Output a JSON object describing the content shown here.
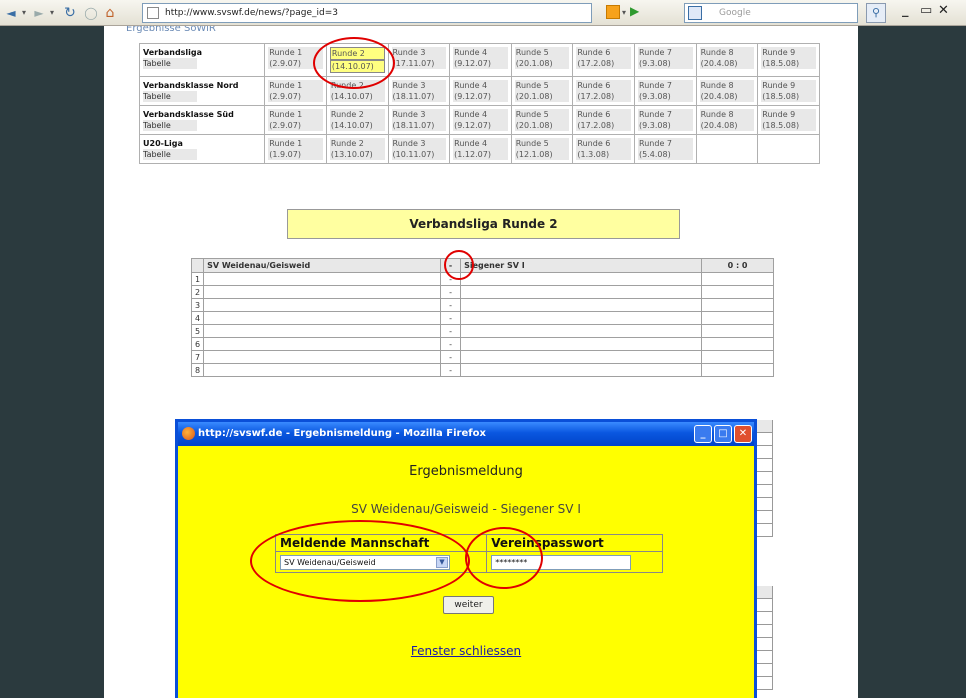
{
  "browser": {
    "url": "http://www.svswf.de/news/?page_id=3",
    "search_placeholder": "Google",
    "back_label": "◄",
    "forward_label": "►",
    "reload_label": "↻",
    "home_label": "⌂",
    "go_label": "▶",
    "minimize_label": "_",
    "restore_label": "ð",
    "close_label": "✕"
  },
  "page": {
    "heading": "Ergebnisse SoWiR",
    "schedule": [
      {
        "league": "Verbandsliga",
        "table": "Tabelle",
        "rounds": [
          [
            "Runde 1",
            "(2.9.07)"
          ],
          [
            "Runde 2",
            "(14.10.07)"
          ],
          [
            "Runde 3",
            "(17.11.07)"
          ],
          [
            "Runde 4",
            "(9.12.07)"
          ],
          [
            "Runde 5",
            "(20.1.08)"
          ],
          [
            "Runde 6",
            "(17.2.08)"
          ],
          [
            "Runde 7",
            "(9.3.08)"
          ],
          [
            "Runde 8",
            "(20.4.08)"
          ],
          [
            "Runde 9",
            "(18.5.08)"
          ]
        ]
      },
      {
        "league": "Verbandsklasse Nord",
        "table": "Tabelle",
        "rounds": [
          [
            "Runde 1",
            "(2.9.07)"
          ],
          [
            "Runde 2",
            "(14.10.07)"
          ],
          [
            "Runde 3",
            "(18.11.07)"
          ],
          [
            "Runde 4",
            "(9.12.07)"
          ],
          [
            "Runde 5",
            "(20.1.08)"
          ],
          [
            "Runde 6",
            "(17.2.08)"
          ],
          [
            "Runde 7",
            "(9.3.08)"
          ],
          [
            "Runde 8",
            "(20.4.08)"
          ],
          [
            "Runde 9",
            "(18.5.08)"
          ]
        ]
      },
      {
        "league": "Verbandsklasse Süd",
        "table": "Tabelle",
        "rounds": [
          [
            "Runde 1",
            "(2.9.07)"
          ],
          [
            "Runde 2",
            "(14.10.07)"
          ],
          [
            "Runde 3",
            "(18.11.07)"
          ],
          [
            "Runde 4",
            "(9.12.07)"
          ],
          [
            "Runde 5",
            "(20.1.08)"
          ],
          [
            "Runde 6",
            "(17.2.08)"
          ],
          [
            "Runde 7",
            "(9.3.08)"
          ],
          [
            "Runde 8",
            "(20.4.08)"
          ],
          [
            "Runde 9",
            "(18.5.08)"
          ]
        ]
      },
      {
        "league": "U20-Liga",
        "table": "Tabelle",
        "rounds": [
          [
            "Runde 1",
            "(1.9.07)"
          ],
          [
            "Runde 2",
            "(13.10.07)"
          ],
          [
            "Runde 3",
            "(10.11.07)"
          ],
          [
            "Runde 4",
            "(1.12.07)"
          ],
          [
            "Runde 5",
            "(12.1.08)"
          ],
          [
            "Runde 6",
            "(1.3.08)"
          ],
          [
            "Runde 7",
            "(5.4.08)"
          ]
        ]
      }
    ],
    "round_title": "Verbandsliga Runde 2",
    "match": {
      "home": "SV Weidenau/Geisweid",
      "separator": "-",
      "away": "Siegener SV I",
      "score": "0 : 0",
      "boards": [
        "1",
        "2",
        "3",
        "4",
        "5",
        "6",
        "7",
        "8"
      ]
    }
  },
  "popup": {
    "title": "http://svswf.de - Ergebnismeldung - Mozilla Firefox",
    "heading": "Ergebnismeldung",
    "subtitle": "SV Weidenau/Geisweid - Siegener SV I",
    "col_team": "Meldende Mannschaft",
    "col_password": "Vereinspasswort",
    "team_value": "SV Weidenau/Geisweid",
    "password_value": "********",
    "submit_label": "weiter",
    "close_label": "Fenster schliessen",
    "btn_min": "_",
    "btn_max": "□",
    "btn_close": "✕"
  }
}
